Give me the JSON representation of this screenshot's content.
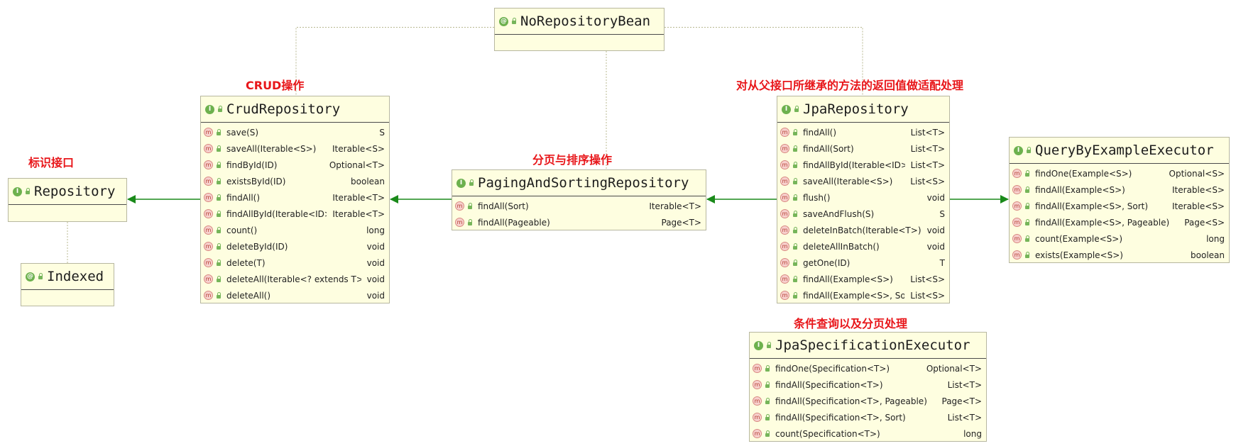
{
  "nodes": {
    "no_repository_bean": {
      "title": "NoRepositoryBean",
      "kind": "annotation",
      "methods": []
    },
    "repository": {
      "title": "Repository",
      "kind": "interface",
      "methods": []
    },
    "indexed": {
      "title": "Indexed",
      "kind": "annotation",
      "methods": []
    },
    "crud_repository": {
      "title": "CrudRepository",
      "kind": "interface",
      "methods": [
        {
          "name": "save(S)",
          "ret": "S"
        },
        {
          "name": "saveAll(Iterable<S>)",
          "ret": "Iterable<S>"
        },
        {
          "name": "findById(ID)",
          "ret": "Optional<T>"
        },
        {
          "name": "existsById(ID)",
          "ret": "boolean"
        },
        {
          "name": "findAll()",
          "ret": "Iterable<T>"
        },
        {
          "name": "findAllById(Iterable<ID>)",
          "ret": "Iterable<T>"
        },
        {
          "name": "count()",
          "ret": "long"
        },
        {
          "name": "deleteById(ID)",
          "ret": "void"
        },
        {
          "name": "delete(T)",
          "ret": "void"
        },
        {
          "name": "deleteAll(Iterable<? extends T>)",
          "ret": "void"
        },
        {
          "name": "deleteAll()",
          "ret": "void"
        }
      ]
    },
    "paging_and_sorting_repository": {
      "title": "PagingAndSortingRepository",
      "kind": "interface",
      "methods": [
        {
          "name": "findAll(Sort)",
          "ret": "Iterable<T>"
        },
        {
          "name": "findAll(Pageable)",
          "ret": "Page<T>"
        }
      ]
    },
    "jpa_repository": {
      "title": "JpaRepository",
      "kind": "interface",
      "methods": [
        {
          "name": "findAll()",
          "ret": "List<T>"
        },
        {
          "name": "findAll(Sort)",
          "ret": "List<T>"
        },
        {
          "name": "findAllById(Iterable<ID>)",
          "ret": "List<T>"
        },
        {
          "name": "saveAll(Iterable<S>)",
          "ret": "List<S>"
        },
        {
          "name": "flush()",
          "ret": "void"
        },
        {
          "name": "saveAndFlush(S)",
          "ret": "S"
        },
        {
          "name": "deleteInBatch(Iterable<T>)",
          "ret": "void"
        },
        {
          "name": "deleteAllInBatch()",
          "ret": "void"
        },
        {
          "name": "getOne(ID)",
          "ret": "T"
        },
        {
          "name": "findAll(Example<S>)",
          "ret": "List<S>"
        },
        {
          "name": "findAll(Example<S>, Sort)",
          "ret": "List<S>"
        }
      ]
    },
    "query_by_example_executor": {
      "title": "QueryByExampleExecutor",
      "kind": "interface",
      "methods": [
        {
          "name": "findOne(Example<S>)",
          "ret": "Optional<S>"
        },
        {
          "name": "findAll(Example<S>)",
          "ret": "Iterable<S>"
        },
        {
          "name": "findAll(Example<S>, Sort)",
          "ret": "Iterable<S>"
        },
        {
          "name": "findAll(Example<S>, Pageable)",
          "ret": "Page<S>"
        },
        {
          "name": "count(Example<S>)",
          "ret": "long"
        },
        {
          "name": "exists(Example<S>)",
          "ret": "boolean"
        }
      ]
    },
    "jpa_specification_executor": {
      "title": "JpaSpecificationExecutor",
      "kind": "interface",
      "methods": [
        {
          "name": "findOne(Specification<T>)",
          "ret": "Optional<T>"
        },
        {
          "name": "findAll(Specification<T>)",
          "ret": "List<T>"
        },
        {
          "name": "findAll(Specification<T>, Pageable)",
          "ret": "Page<T>"
        },
        {
          "name": "findAll(Specification<T>, Sort)",
          "ret": "List<T>"
        },
        {
          "name": "count(Specification<T>)",
          "ret": "long"
        }
      ]
    }
  },
  "notes": {
    "marker": "标识接口",
    "crud": "CRUD操作",
    "paging": "分页与排序操作",
    "jpa": "对从父接口所继承的方法的返回值做适配处理",
    "spec": "条件查询以及分页处理"
  },
  "icons": {
    "interface": "I",
    "annotation": "@",
    "method": "m"
  },
  "edges": [
    {
      "from": "crud_repository",
      "to": "repository",
      "type": "extends"
    },
    {
      "from": "paging_and_sorting_repository",
      "to": "crud_repository",
      "type": "extends"
    },
    {
      "from": "jpa_repository",
      "to": "paging_and_sorting_repository",
      "type": "extends"
    },
    {
      "from": "jpa_repository",
      "to": "query_by_example_executor",
      "type": "extends"
    },
    {
      "from": "no_repository_bean",
      "to": "crud_repository",
      "type": "annotated"
    },
    {
      "from": "no_repository_bean",
      "to": "paging_and_sorting_repository",
      "type": "annotated"
    },
    {
      "from": "no_repository_bean",
      "to": "jpa_repository",
      "type": "annotated"
    },
    {
      "from": "indexed",
      "to": "repository",
      "type": "annotated"
    }
  ],
  "colors": {
    "box_fill": "#fefee0",
    "box_border": "#b7b7a0",
    "extends_line": "#1a8a1a",
    "annotation_line": "#b8b890",
    "note_text": "#e8161a",
    "interface_badge": "#6db14e",
    "method_badge": "#f7d0cd"
  }
}
